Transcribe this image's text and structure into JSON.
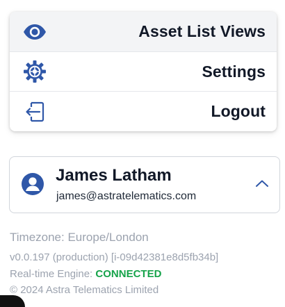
{
  "menu": {
    "items": [
      {
        "label": "Asset List Views",
        "icon": "eye-icon",
        "active": true
      },
      {
        "label": "Settings",
        "icon": "gear-icon",
        "active": false
      },
      {
        "label": "Logout",
        "icon": "logout-icon",
        "active": false
      }
    ]
  },
  "user": {
    "name": "James Latham",
    "email": "james@astratelematics.com",
    "avatar_icon": "user-circle-icon",
    "toggle_icon": "chevron-up-icon"
  },
  "info": {
    "timezone": "Timezone: Europe/London",
    "version": "v0.0.197 (production) [i-09d42381e8d5fb34b]",
    "engine_label": "Real-time Engine: ",
    "engine_status": "CONNECTED",
    "copyright": "© 2024 Astra Telematics Limited"
  },
  "colors": {
    "accent": "#2f57a8",
    "status_ok": "#16a34a",
    "muted": "#9ca3af",
    "text": "#111827"
  }
}
